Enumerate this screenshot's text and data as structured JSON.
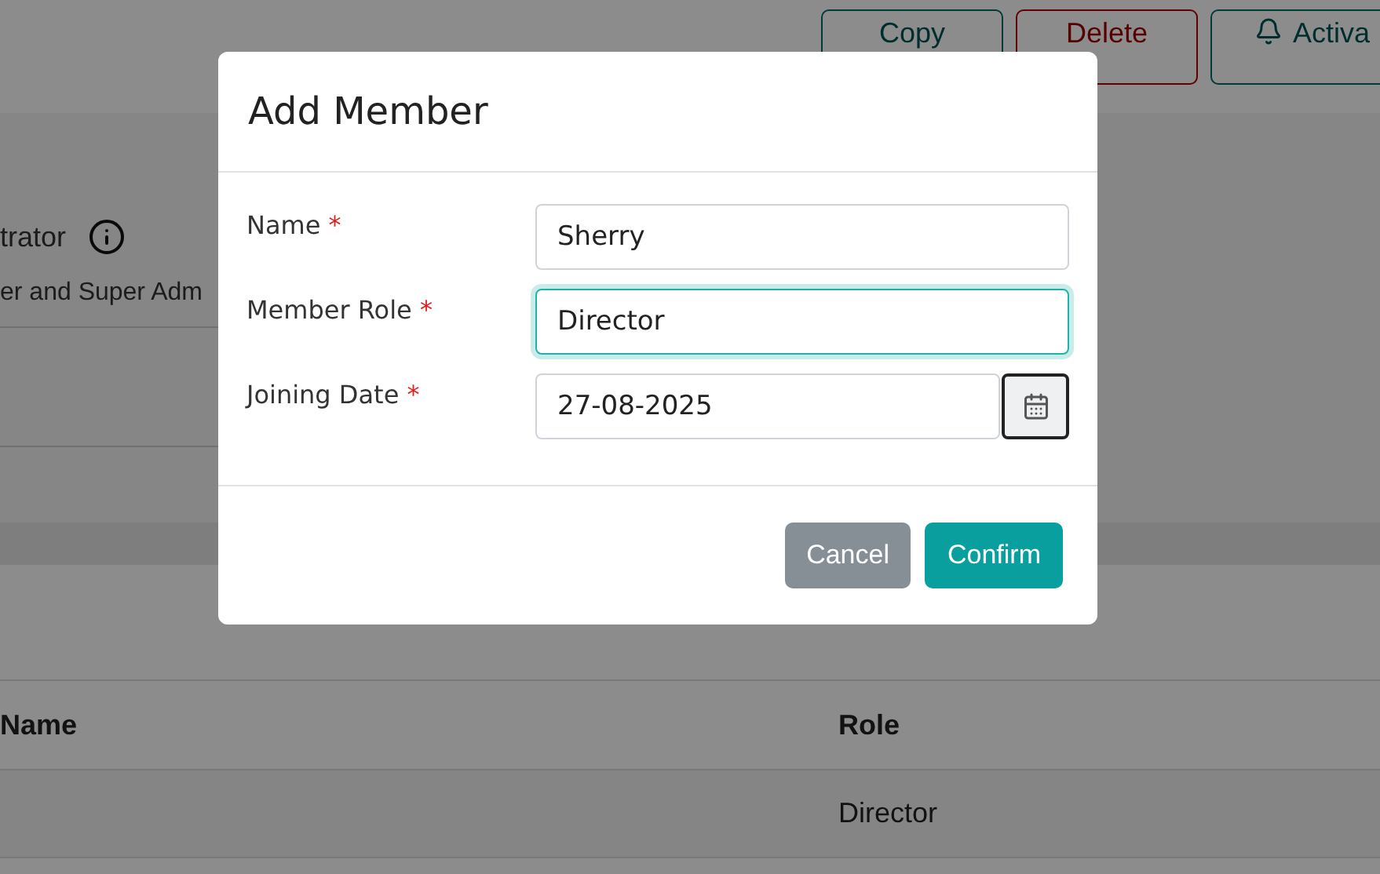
{
  "page": {
    "actions": [
      {
        "label": "Copy",
        "kind": "copy"
      },
      {
        "label": "Delete",
        "kind": "delete"
      },
      {
        "label": "Activa",
        "kind": "bell"
      }
    ],
    "info_label": "trator",
    "info_text": "er and Super Adm",
    "table": {
      "columns": [
        "Name",
        "Role"
      ],
      "rows": [
        [
          "",
          "Director"
        ]
      ]
    }
  },
  "dialog": {
    "title": "Add Member",
    "fields": [
      {
        "label": "Name",
        "mark": "*",
        "value": "Sherry",
        "focused": false,
        "kind": "text"
      },
      {
        "label": "Member Role",
        "mark": "*",
        "value": "Director",
        "focused": true,
        "kind": "text"
      },
      {
        "label": "Joining Date",
        "mark": "*",
        "value": "27-08-2025",
        "focused": false,
        "kind": "date"
      }
    ],
    "buttons": [
      {
        "label": "Cancel",
        "kind": "secondary"
      },
      {
        "label": "Confirm",
        "kind": "primary"
      }
    ]
  }
}
